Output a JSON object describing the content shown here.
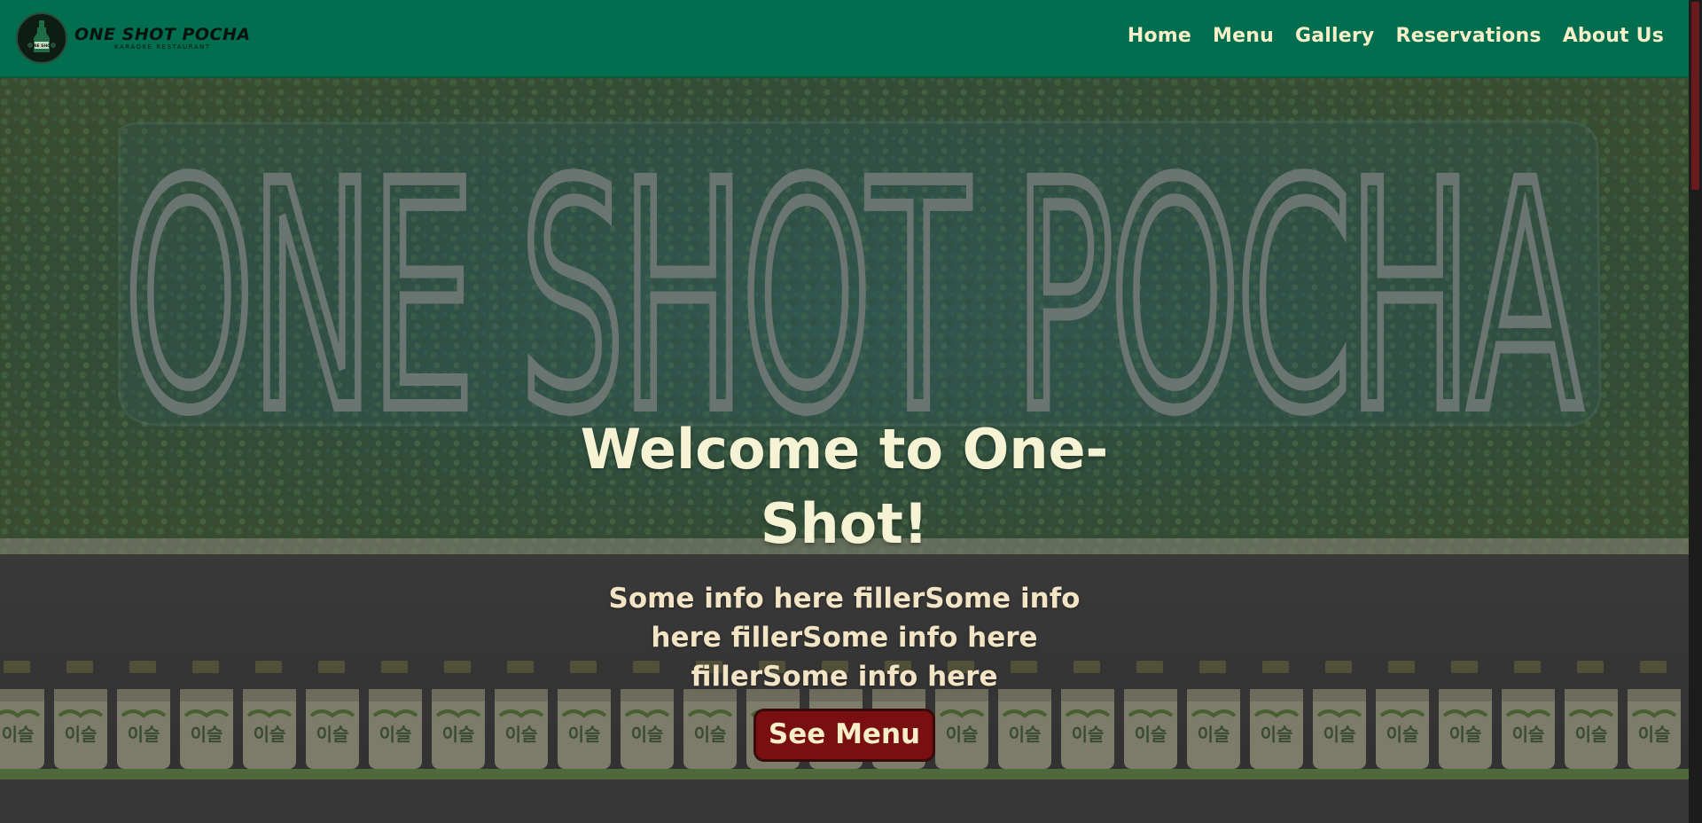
{
  "header": {
    "logo_name": "ONE SHOT POCHA",
    "logo_sub": "KARAOKE RESTAURANT",
    "logo_badge_text": "ONE SHOT"
  },
  "nav": {
    "items": [
      {
        "label": "Home"
      },
      {
        "label": "Menu"
      },
      {
        "label": "Gallery"
      },
      {
        "label": "Reservations"
      },
      {
        "label": "About Us"
      }
    ]
  },
  "hero": {
    "neon_sign_text": "ONE SHOT POCHA",
    "title": "Welcome to One-Shot!",
    "text": "Some info here fillerSome info here fillerSome info here fillerSome info here",
    "cta_label": "See Menu",
    "bottle_label_text": "이슬"
  },
  "colors": {
    "header_bg": "#006e4f",
    "nav_text": "#f6efc7",
    "cta_bg": "#7a0f12",
    "title_text": "#f6f3d4"
  }
}
